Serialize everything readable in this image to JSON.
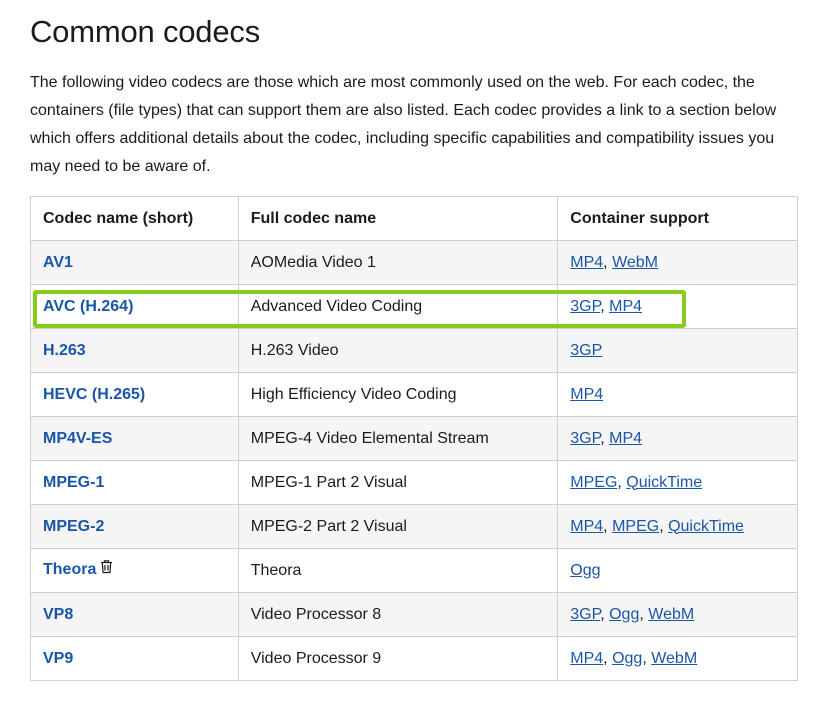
{
  "heading": "Common codecs",
  "intro": "The following video codecs are those which are most commonly used on the web. For each codec, the containers (file types) that can support them are also listed. Each codec provides a link to a section below which offers additional details about the codec, including specific capabilities and compatibility issues you may need to be aware of.",
  "table": {
    "headers": [
      "Codec name (short)",
      "Full codec name",
      "Container support"
    ],
    "rows": [
      {
        "short": "AV1",
        "full": "AOMedia Video 1",
        "containers": [
          "MP4",
          "WebM"
        ],
        "deprecated": false
      },
      {
        "short": "AVC (H.264)",
        "full": "Advanced Video Coding",
        "containers": [
          "3GP",
          "MP4"
        ],
        "deprecated": false
      },
      {
        "short": "H.263",
        "full": "H.263 Video",
        "containers": [
          "3GP"
        ],
        "deprecated": false
      },
      {
        "short": "HEVC (H.265)",
        "full": "High Efficiency Video Coding",
        "containers": [
          "MP4"
        ],
        "deprecated": false
      },
      {
        "short": "MP4V-ES",
        "full": "MPEG-4 Video Elemental Stream",
        "containers": [
          "3GP",
          "MP4"
        ],
        "deprecated": false
      },
      {
        "short": "MPEG-1",
        "full": "MPEG-1 Part 2 Visual",
        "containers": [
          "MPEG",
          "QuickTime"
        ],
        "deprecated": false
      },
      {
        "short": "MPEG-2",
        "full": "MPEG-2 Part 2 Visual",
        "containers": [
          "MP4",
          "MPEG",
          "QuickTime"
        ],
        "deprecated": false
      },
      {
        "short": "Theora",
        "full": "Theora",
        "containers": [
          "Ogg"
        ],
        "deprecated": true
      },
      {
        "short": "VP8",
        "full": "Video Processor 8",
        "containers": [
          "3GP",
          "Ogg",
          "WebM"
        ],
        "deprecated": false
      },
      {
        "short": "VP9",
        "full": "Video Processor 9",
        "containers": [
          "MP4",
          "Ogg",
          "WebM"
        ],
        "deprecated": false
      }
    ]
  },
  "highlight": {
    "row": "AVC (H.264)",
    "color": "#84cc16"
  },
  "colors": {
    "link": "#1a56a8",
    "border": "#cfcfcf",
    "stripe": "#f5f5f5"
  },
  "icons": {
    "deprecated": "trash-icon"
  }
}
